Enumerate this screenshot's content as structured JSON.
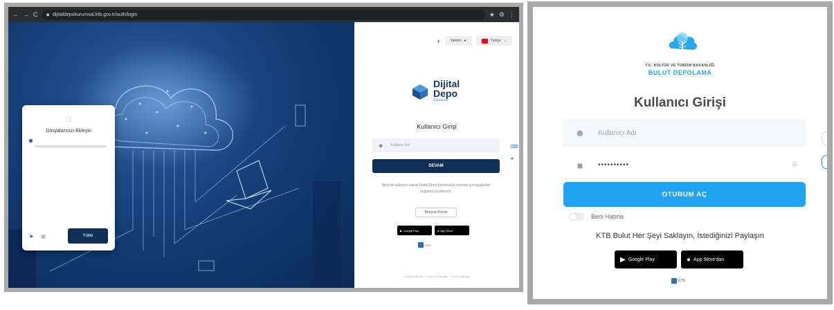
{
  "left_screenshot": {
    "browser": {
      "url": "dijitaldepokurumsal.ktb.gov.tr/auth/login",
      "nav_back": "←",
      "nav_forward": "→",
      "nav_reload": "C"
    },
    "document_card": {
      "title": "Dosyalarınızı Ekleyin",
      "button_label": "Yükle"
    },
    "login": {
      "language_label": "Türkçe",
      "help_label": "Yardım",
      "brand_line1": "Dijital",
      "brand_line2": "Depo",
      "brand_sub": "Kurumsal",
      "title": "Kullanıcı Girişi",
      "username_placeholder": "Kullanıcı Adı",
      "submit_label": "DEVAM",
      "note": "Bireysel kullanıcı olarak Dijital Depo Kurumsal'a erişmek için aşağıdaki bağlantıyı kullanınız.",
      "outline_button": "Bireysel Portal",
      "google_play": "Google Play",
      "app_store": "App Store",
      "footer_logo": "KTB",
      "footer": "Gizlilik Politikası · Kullanım Koşulları · Çerez Politikası"
    }
  },
  "right_screenshot": {
    "ministry": "T.C. KÜLTÜR VE TURİZM BAKANLIĞI",
    "storage": "BULUT DEPOLAMA",
    "title": "Kullanıcı Girişi",
    "username_placeholder": "Kullanıcı Adı",
    "password_value": "••••••••••",
    "submit_label": "OTURUM AÇ",
    "remember_label": "Beni Hatırla",
    "tagline": "KTB Bulut Her Şeyi Saklayın, İstediğinizi Paylaşın",
    "google_play_label": "Google Play",
    "app_store_label": "App Store'dan",
    "footer_logo": "KTB"
  },
  "colors": {
    "hero_dark": "#0b2a58",
    "brand_navy": "#0f2f57",
    "accent_blue": "#1ea4f0"
  }
}
